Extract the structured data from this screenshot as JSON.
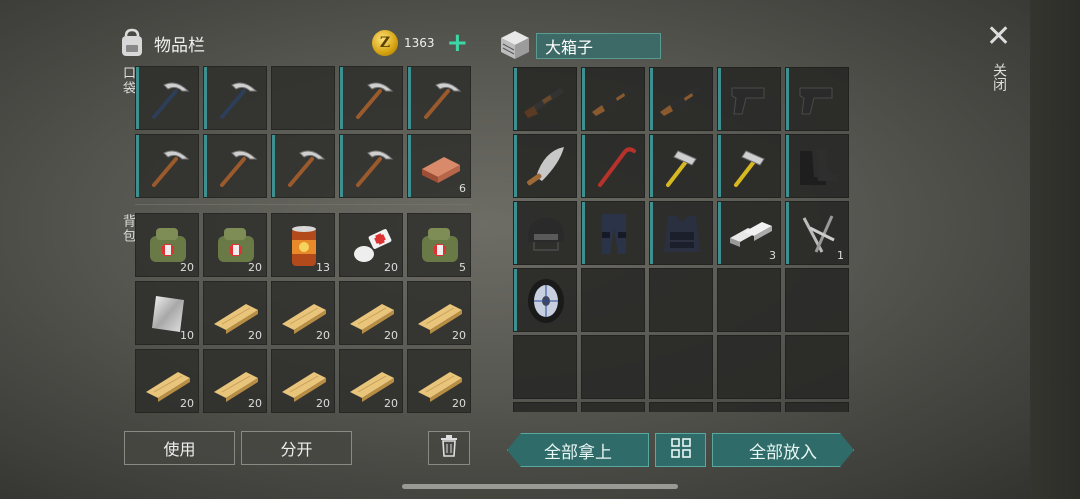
{
  "inventory": {
    "title": "物品栏",
    "coins": "1363",
    "coin_symbol": "Z",
    "add_coins_icon": "+",
    "pocket_label": "口袋",
    "backpack_label": "背包",
    "pocket_items": [
      {
        "icon": "pickaxe-dark",
        "count": ""
      },
      {
        "icon": "pickaxe-dark",
        "count": ""
      },
      {
        "icon": "empty",
        "count": ""
      },
      {
        "icon": "pickaxe",
        "count": ""
      },
      {
        "icon": "pickaxe",
        "count": ""
      },
      {
        "icon": "pickaxe",
        "count": ""
      },
      {
        "icon": "pickaxe",
        "count": ""
      },
      {
        "icon": "pickaxe",
        "count": ""
      },
      {
        "icon": "pickaxe",
        "count": ""
      },
      {
        "icon": "copper-ingot",
        "count": "6"
      }
    ],
    "backpack_items": [
      {
        "icon": "medkit",
        "count": "20"
      },
      {
        "icon": "medkit",
        "count": "20"
      },
      {
        "icon": "canned-food",
        "count": "13"
      },
      {
        "icon": "bandage",
        "count": "20"
      },
      {
        "icon": "medkit",
        "count": "5"
      },
      {
        "icon": "metal-sheet",
        "count": "10"
      },
      {
        "icon": "plank",
        "count": "20"
      },
      {
        "icon": "plank",
        "count": "20"
      },
      {
        "icon": "plank",
        "count": "20"
      },
      {
        "icon": "plank",
        "count": "20"
      },
      {
        "icon": "plank",
        "count": "20"
      },
      {
        "icon": "plank",
        "count": "20"
      },
      {
        "icon": "plank",
        "count": "20"
      },
      {
        "icon": "plank",
        "count": "20"
      },
      {
        "icon": "plank",
        "count": "20"
      }
    ],
    "use_button": "使用",
    "split_button": "分开"
  },
  "box": {
    "title": "大箱子",
    "items": [
      {
        "icon": "shotgun",
        "count": ""
      },
      {
        "icon": "assault-rifle",
        "count": ""
      },
      {
        "icon": "assault-rifle",
        "count": ""
      },
      {
        "icon": "pistol",
        "count": ""
      },
      {
        "icon": "pistol",
        "count": ""
      },
      {
        "icon": "machete",
        "count": ""
      },
      {
        "icon": "crowbar",
        "count": ""
      },
      {
        "icon": "hammer",
        "count": ""
      },
      {
        "icon": "hammer",
        "count": ""
      },
      {
        "icon": "boots",
        "count": ""
      },
      {
        "icon": "helmet",
        "count": ""
      },
      {
        "icon": "armored-pants",
        "count": ""
      },
      {
        "icon": "body-armor",
        "count": ""
      },
      {
        "icon": "iron-ingot",
        "count": "3"
      },
      {
        "icon": "nails",
        "count": "1"
      },
      {
        "icon": "tire",
        "count": ""
      }
    ],
    "take_all_button": "全部拿上",
    "put_all_button": "全部放入"
  },
  "close_label": "关闭",
  "colors": {
    "accent": "#3dd6a6",
    "teal": "#2f6b68"
  }
}
